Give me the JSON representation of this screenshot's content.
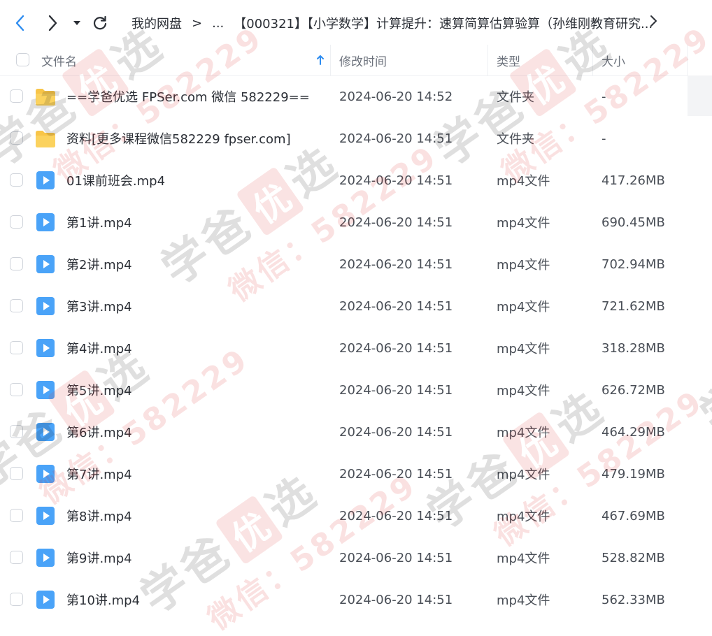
{
  "toolbar": {
    "breadcrumb": [
      "我的网盘",
      "...",
      "【000321】【小学数学】计算提升：速算简算估算验算（孙维刚教育研究..."
    ]
  },
  "columns": {
    "name": "文件名",
    "modified": "修改时间",
    "type": "类型",
    "size": "大小"
  },
  "files": [
    {
      "name": "==学爸优选 FPSer.com 微信 582229==",
      "modified": "2024-06-20 14:52",
      "type": "文件夹",
      "size": "-",
      "icon": "folder-icon"
    },
    {
      "name": "资料[更多课程微信582229 fpser.com]",
      "modified": "2024-06-20 14:51",
      "type": "文件夹",
      "size": "-",
      "icon": "folder-icon"
    },
    {
      "name": "01课前班会.mp4",
      "modified": "2024-06-20 14:51",
      "type": "mp4文件",
      "size": "417.26MB",
      "icon": "video-file-icon"
    },
    {
      "name": "第1讲.mp4",
      "modified": "2024-06-20 14:51",
      "type": "mp4文件",
      "size": "690.45MB",
      "icon": "video-file-icon"
    },
    {
      "name": "第2讲.mp4",
      "modified": "2024-06-20 14:51",
      "type": "mp4文件",
      "size": "702.94MB",
      "icon": "video-file-icon"
    },
    {
      "name": "第3讲.mp4",
      "modified": "2024-06-20 14:51",
      "type": "mp4文件",
      "size": "721.62MB",
      "icon": "video-file-icon"
    },
    {
      "name": "第4讲.mp4",
      "modified": "2024-06-20 14:51",
      "type": "mp4文件",
      "size": "318.28MB",
      "icon": "video-file-icon"
    },
    {
      "name": "第5讲.mp4",
      "modified": "2024-06-20 14:51",
      "type": "mp4文件",
      "size": "626.72MB",
      "icon": "video-file-icon"
    },
    {
      "name": "第6讲.mp4",
      "modified": "2024-06-20 14:51",
      "type": "mp4文件",
      "size": "464.29MB",
      "icon": "video-file-icon"
    },
    {
      "name": "第7讲.mp4",
      "modified": "2024-06-20 14:51",
      "type": "mp4文件",
      "size": "479.19MB",
      "icon": "video-file-icon"
    },
    {
      "name": "第8讲.mp4",
      "modified": "2024-06-20 14:51",
      "type": "mp4文件",
      "size": "467.69MB",
      "icon": "video-file-icon"
    },
    {
      "name": "第9讲.mp4",
      "modified": "2024-06-20 14:51",
      "type": "mp4文件",
      "size": "528.82MB",
      "icon": "video-file-icon"
    },
    {
      "name": "第10讲.mp4",
      "modified": "2024-06-20 14:51",
      "type": "mp4文件",
      "size": "562.33MB",
      "icon": "video-file-icon"
    }
  ],
  "watermark": {
    "text_1": "学爸",
    "text_2": "优",
    "text_3": "选",
    "text_4": "微信：582229"
  },
  "colors": {
    "accent": "#2d8cf0",
    "folder": "#f8c549",
    "video": "#4aa3f8"
  }
}
